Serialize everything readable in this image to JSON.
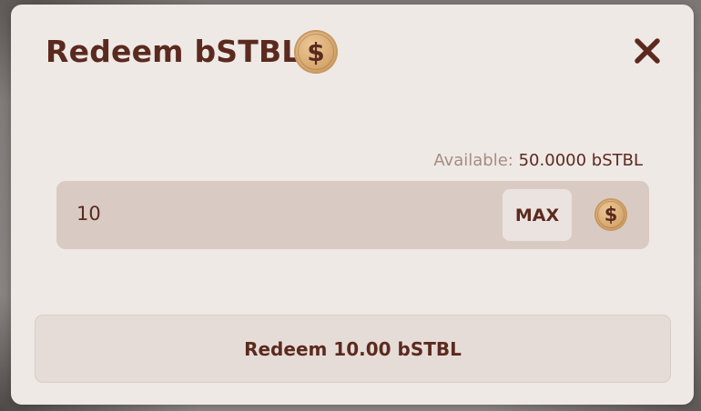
{
  "modal": {
    "title": "Redeem bSTBL",
    "title_icon": "dollar-coin-icon",
    "close_icon": "close-icon"
  },
  "balance": {
    "label": "Available:",
    "value": "50.0000 bSTBL"
  },
  "input": {
    "value": "10",
    "max_label": "MAX",
    "token_icon": "dollar-coin-icon"
  },
  "action": {
    "label": "Redeem 10.00 bSTBL"
  },
  "colors": {
    "primary_text": "#5b2a1e",
    "modal_bg": "#efe9e6",
    "input_bg": "#d9cbc3",
    "muted_label": "#a58d80",
    "coin_gold": "#d9aa72"
  }
}
